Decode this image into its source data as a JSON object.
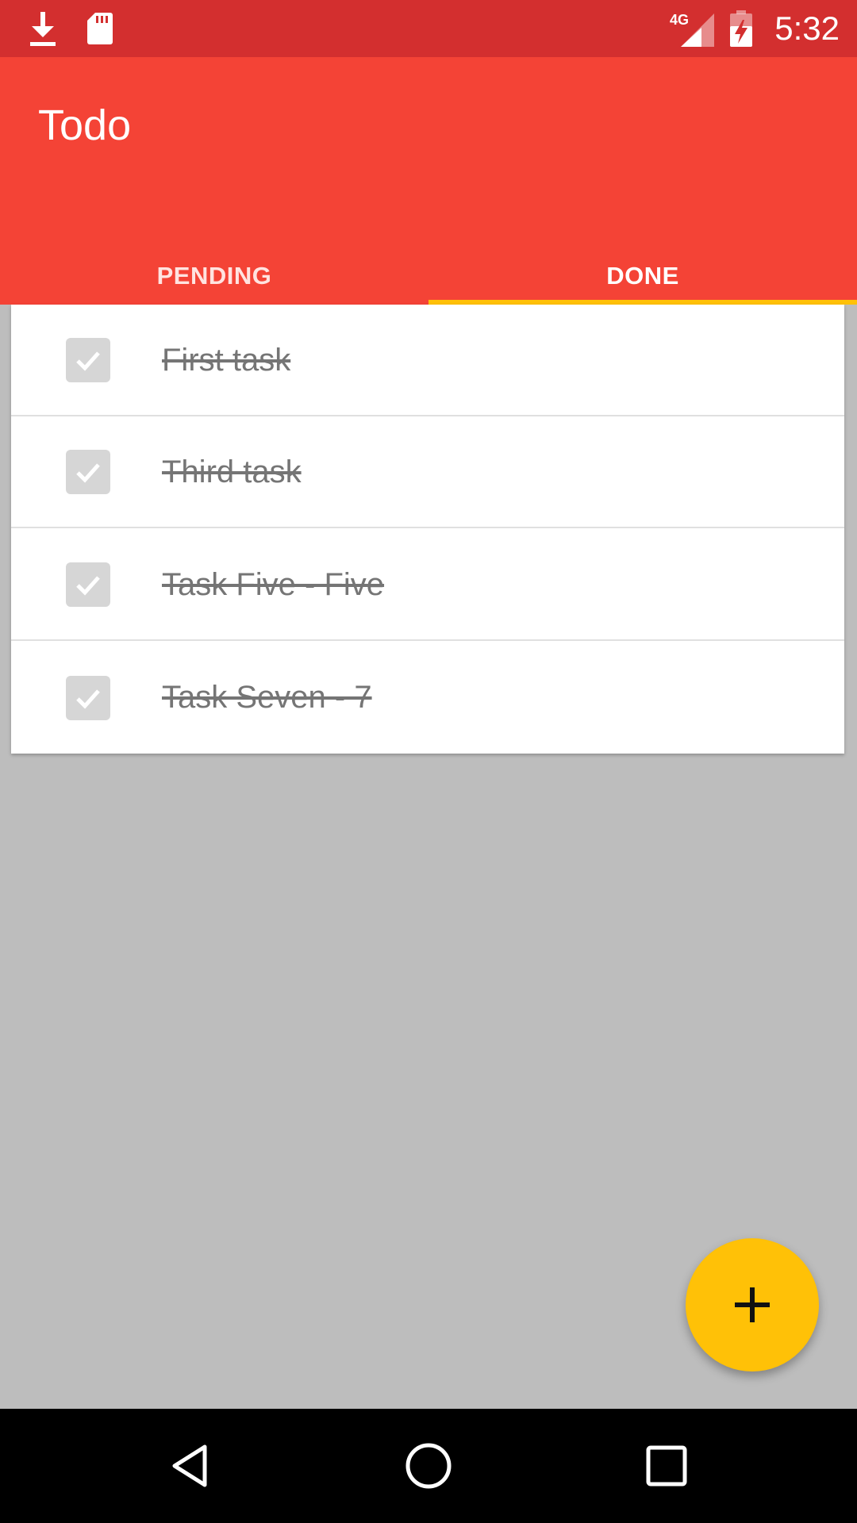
{
  "status_bar": {
    "time": "5:32",
    "network": "4G",
    "icons": [
      "download-icon",
      "sd-card-icon",
      "signal-icon",
      "battery-charging-icon"
    ]
  },
  "app": {
    "title": "Todo"
  },
  "tabs": [
    {
      "label": "PENDING",
      "selected": false
    },
    {
      "label": "DONE",
      "selected": true
    }
  ],
  "tasks": [
    {
      "text": "First task",
      "checked": true
    },
    {
      "text": "Third task",
      "checked": true
    },
    {
      "text": "Task Five - Five",
      "checked": true
    },
    {
      "text": "Task Seven - 7",
      "checked": true
    }
  ],
  "fab": {
    "icon": "plus-icon"
  },
  "nav_bar": {
    "icons": [
      "back-icon",
      "home-icon",
      "recents-icon"
    ]
  },
  "colors": {
    "status_bar": "#d32f2f",
    "app_bar": "#f44336",
    "accent": "#ffc107",
    "background": "#bdbdbd"
  }
}
